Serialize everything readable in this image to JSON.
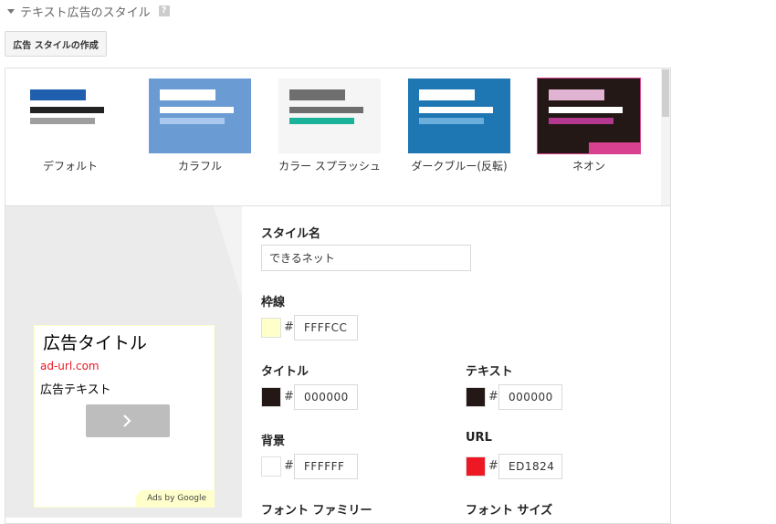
{
  "header": {
    "title": "テキスト広告のスタイル",
    "help_icon": "?"
  },
  "toolbar": {
    "create_label": "広告 スタイルの作成"
  },
  "templates": [
    {
      "label": "デフォルト",
      "colors": {
        "bg": "#ffffff",
        "title_bar": "#1f5fae",
        "text_bar": "#222222",
        "url_bar": "#9e9e9e"
      }
    },
    {
      "label": "カラフル",
      "colors": {
        "bg": "#6a9bd3",
        "title_bar": "#ffffff",
        "text_bar": "#ffffff",
        "url_bar": "#a9c9ef"
      }
    },
    {
      "label": "カラー スプラッシュ",
      "colors": {
        "bg": "#f5f5f5",
        "title_bar": "#6e6e6e",
        "text_bar": "#6e6e6e",
        "url_bar": "#1ab39a"
      }
    },
    {
      "label": "ダークブルー(反転)",
      "colors": {
        "bg": "#1e76b3",
        "title_bar": "#ffffff",
        "text_bar": "#ffffff",
        "url_bar": "#6aaedb"
      }
    },
    {
      "label": "ネオン",
      "colors": {
        "bg": "#231815",
        "title_bar": "#e1b3d3",
        "text_bar": "#ffffff",
        "url_bar": "#b2398f",
        "corner": "#d7418f",
        "border": "#d7418f"
      }
    }
  ],
  "preview": {
    "ad_title": "広告タイトル",
    "ad_url": "ad-url.com",
    "ad_text": "広告テキスト",
    "button_icon": "chevron-right-icon",
    "ads_by": "Ads by Google"
  },
  "form": {
    "style_name": {
      "label": "スタイル名",
      "value": "できるネット"
    },
    "border": {
      "label": "枠線",
      "hash": "#",
      "value": "FFFFCC",
      "color": "#FFFFCC"
    },
    "title": {
      "label": "タイトル",
      "hash": "#",
      "value": "000000",
      "color": "#231815"
    },
    "text": {
      "label": "テキスト",
      "hash": "#",
      "value": "000000",
      "color": "#231815"
    },
    "background": {
      "label": "背景",
      "hash": "#",
      "value": "FFFFFF",
      "color": "#FFFFFF"
    },
    "url": {
      "label": "URL",
      "hash": "#",
      "value": "ED1824",
      "color": "#ED1824"
    },
    "font_family": {
      "label": "フォント ファミリー"
    },
    "font_size": {
      "label": "フォント サイズ"
    }
  }
}
